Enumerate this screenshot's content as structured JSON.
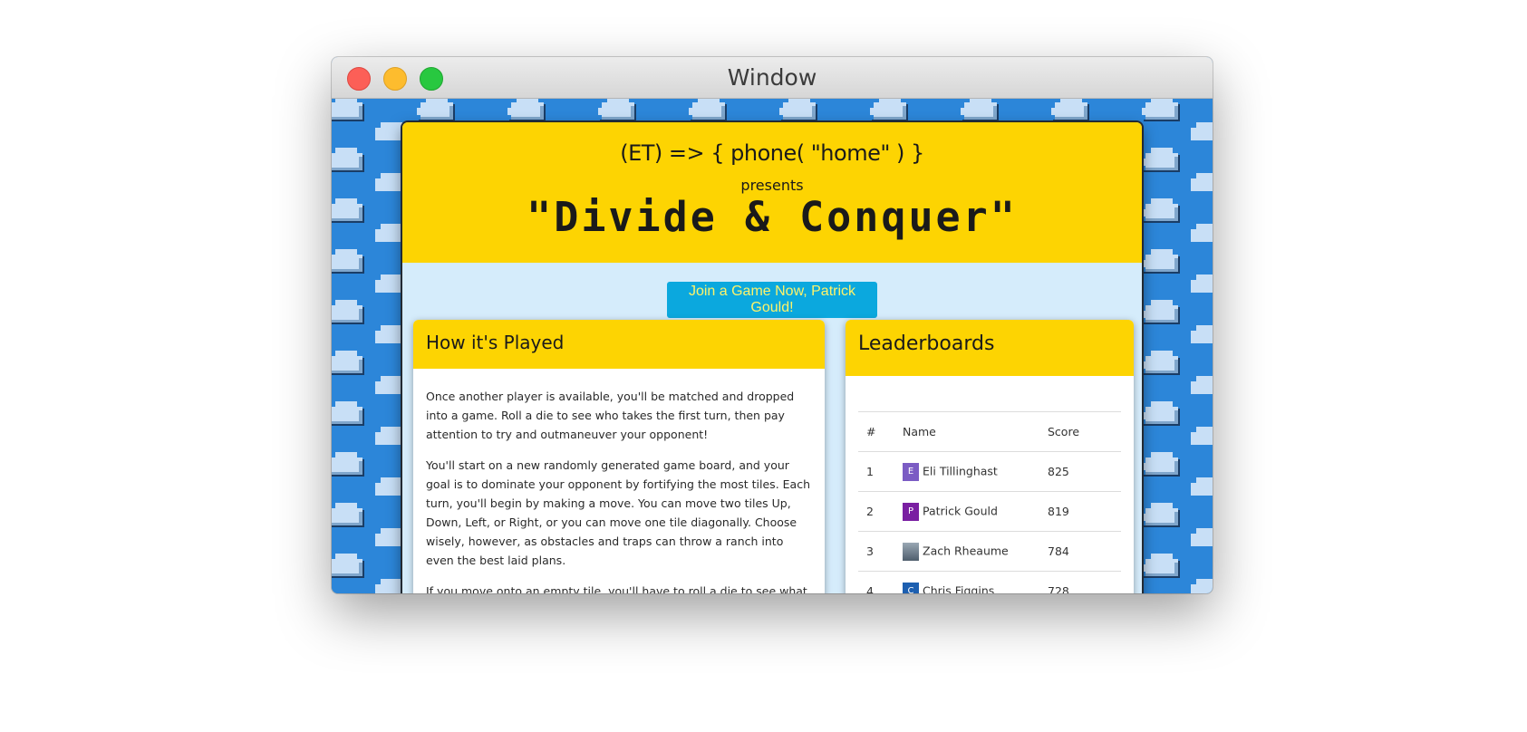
{
  "window": {
    "title": "Window"
  },
  "hero": {
    "tagline": "(ET) => { phone( \"home\" ) }",
    "presents": "presents",
    "title": "\"Divide & Conquer\""
  },
  "join_button": "Join a Game Now, Patrick Gould!",
  "how_played": {
    "heading": "How it's Played",
    "paragraphs": [
      "Once another player is available, you'll be matched and dropped into a game. Roll a die to see who takes the first turn, then pay attention to try and outmaneuver your opponent!",
      "You'll start on a new randomly generated game board, and your goal is to dominate your opponent by fortifying the most tiles. Each turn, you'll begin by making a move. You can move two tiles Up, Down, Left, or Right, or you can move one tile diagonally. Choose wisely, however, as obstacles and traps can throw a ranch into even the best laid plans.",
      "If you move onto an empty tile, you'll have to roll a die to see what resources are on the tiles. If you roll a one, you become the owner of that tile and establish a"
    ]
  },
  "leaderboard": {
    "heading": "Leaderboards",
    "columns": [
      "#",
      "Name",
      "Score"
    ],
    "rows": [
      {
        "rank": "1",
        "name": "Eli Tillinghast",
        "score": "825",
        "initial": "E",
        "color": "#7b5cc4"
      },
      {
        "rank": "2",
        "name": "Patrick Gould",
        "score": "819",
        "initial": "P",
        "color": "#7a1fa2"
      },
      {
        "rank": "3",
        "name": "Zach Rheaume",
        "score": "784",
        "initial": "",
        "color": "#6a7b8c"
      },
      {
        "rank": "4",
        "name": "Chris Figgins",
        "score": "728",
        "initial": "C",
        "color": "#1d5fb0"
      }
    ]
  },
  "colors": {
    "accent_yellow": "#fdd402",
    "button_blue": "#0ba8de",
    "button_text": "#fff36a",
    "card_background": "#d5ecfb",
    "sky_blue": "#2c86d9"
  }
}
